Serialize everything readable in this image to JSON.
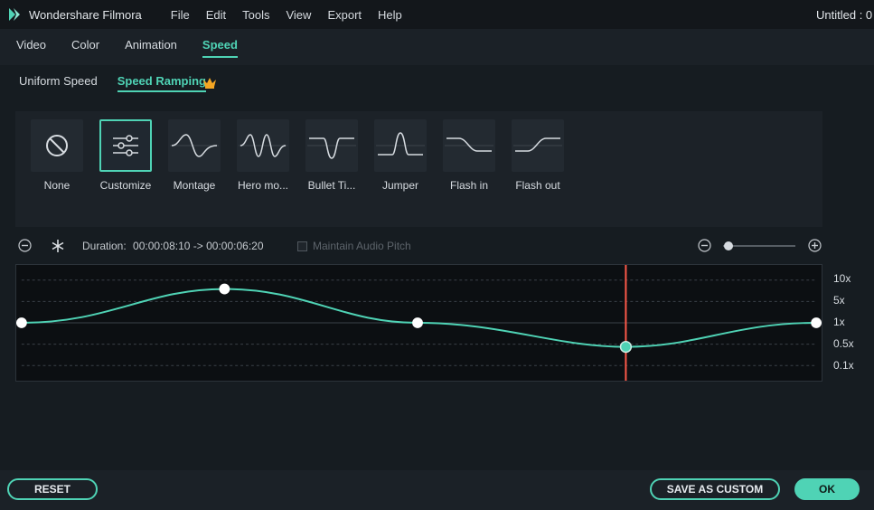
{
  "app": {
    "name": "Wondershare Filmora",
    "document_title": "Untitled : 0"
  },
  "menu": [
    "File",
    "Edit",
    "Tools",
    "View",
    "Export",
    "Help"
  ],
  "tabs": [
    {
      "label": "Video",
      "active": false
    },
    {
      "label": "Color",
      "active": false
    },
    {
      "label": "Animation",
      "active": false
    },
    {
      "label": "Speed",
      "active": true
    }
  ],
  "subtabs": [
    {
      "label": "Uniform Speed",
      "active": false
    },
    {
      "label": "Speed Ramping",
      "active": true
    }
  ],
  "presets": [
    {
      "label": "None",
      "icon": "none-icon",
      "selected": false
    },
    {
      "label": "Customize",
      "icon": "sliders-icon",
      "selected": true
    },
    {
      "label": "Montage",
      "icon": "montage-curve-icon",
      "selected": false
    },
    {
      "label": "Hero mo...",
      "icon": "hero-moment-curve-icon",
      "selected": false
    },
    {
      "label": "Bullet Ti...",
      "icon": "bullet-time-curve-icon",
      "selected": false
    },
    {
      "label": "Jumper",
      "icon": "jumper-curve-icon",
      "selected": false
    },
    {
      "label": "Flash in",
      "icon": "flash-in-curve-icon",
      "selected": false
    },
    {
      "label": "Flash out",
      "icon": "flash-out-curve-icon",
      "selected": false
    }
  ],
  "controls": {
    "duration_label": "Duration:",
    "duration_value": "00:00:08:10 -> 00:00:06:20",
    "maintain_pitch_label": "Maintain Audio Pitch",
    "maintain_pitch_checked": false
  },
  "speed_graph": {
    "y_labels": [
      "10x",
      "5x",
      "1x",
      "0.5x",
      "0.1x"
    ],
    "playhead_fraction": 0.763,
    "points": [
      {
        "t": 0.0,
        "speed": "1x"
      },
      {
        "t": 0.254,
        "speed": "between 5x and 10x"
      },
      {
        "t": 0.501,
        "speed": "1x"
      },
      {
        "t": 0.763,
        "speed": "0.5x"
      },
      {
        "t": 1.0,
        "speed": "1x"
      }
    ]
  },
  "footer": {
    "reset_label": "RESET",
    "save_custom_label": "SAVE AS CUSTOM",
    "ok_label": "OK"
  },
  "colors": {
    "accent": "#4fd3b5",
    "playhead": "#ff5a4a",
    "background": "#1b2127",
    "panel": "#161c21"
  }
}
